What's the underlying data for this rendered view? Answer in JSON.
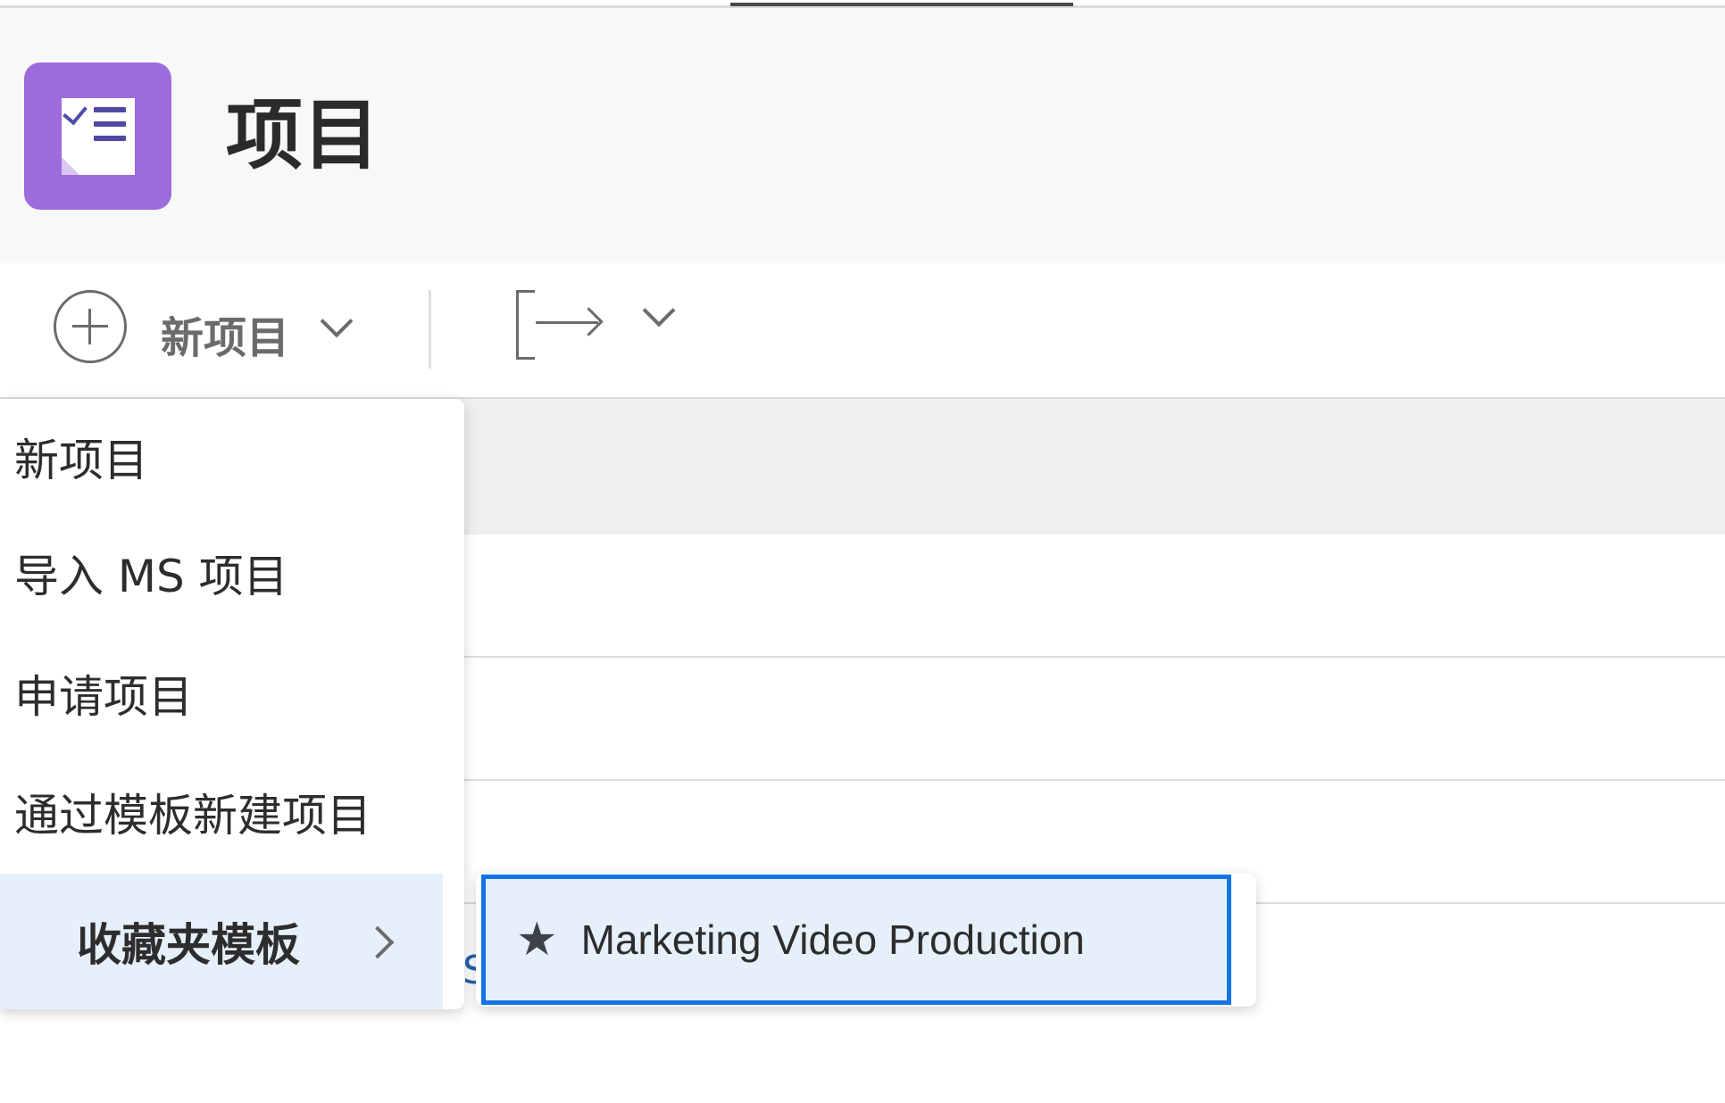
{
  "header": {
    "title": "项目"
  },
  "toolbar": {
    "new_project_label": "新项目"
  },
  "dropdown": {
    "items": [
      {
        "label": "新项目"
      },
      {
        "label": "导入 MS 项目"
      },
      {
        "label": "申请项目"
      },
      {
        "label": "通过模板新建项目"
      },
      {
        "label": "收藏夹模板",
        "selected": true
      }
    ]
  },
  "submenu": {
    "items": [
      {
        "label": "Marketing Video Production",
        "icon": "star-icon"
      }
    ]
  },
  "table": {
    "partial_link_text": "S"
  },
  "colors": {
    "app_icon_bg": "#9e6bdc",
    "selection_bg": "#e6f0fa",
    "focus_border": "#1473e6"
  }
}
